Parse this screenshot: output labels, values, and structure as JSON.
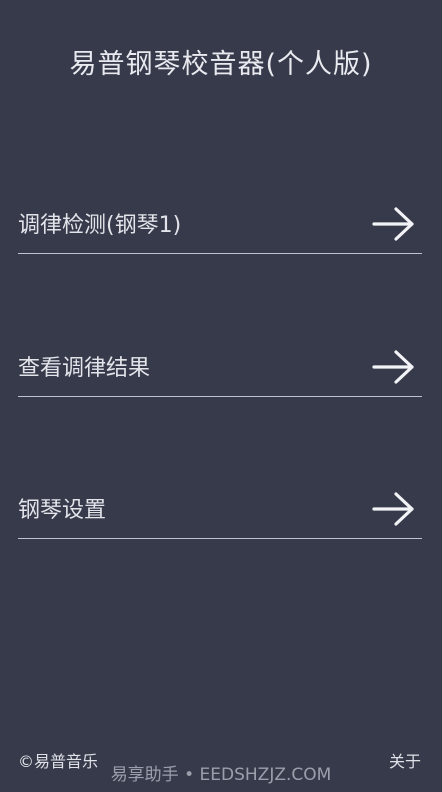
{
  "header": {
    "title": "易普钢琴校音器(个人版)"
  },
  "menu": {
    "items": [
      {
        "label": "调律检测(钢琴1)",
        "icon": "arrow-right-icon"
      },
      {
        "label": "查看调律结果",
        "icon": "arrow-right-icon"
      },
      {
        "label": "钢琴设置",
        "icon": "arrow-right-icon"
      }
    ]
  },
  "footer": {
    "copyright": "©易普音乐",
    "about": "关于"
  },
  "watermark": {
    "text": "易享助手 • EEDSHZJZ.COM"
  },
  "colors": {
    "background": "#363a4b",
    "text": "#e6e7ec",
    "divider": "#bfc2cc"
  }
}
